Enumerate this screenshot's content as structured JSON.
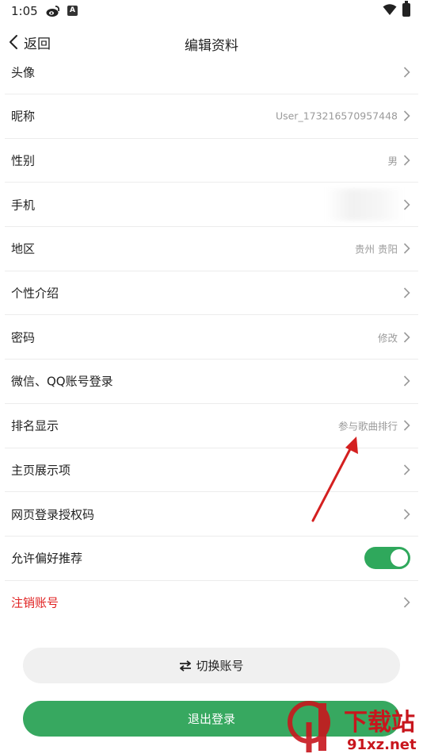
{
  "status_bar": {
    "time": "1:05",
    "icons": [
      "weibo-icon",
      "a-icon",
      "wifi-icon",
      "battery-icon"
    ],
    "a_glyph": "A"
  },
  "header": {
    "back_label": "返回",
    "title": "编辑资料"
  },
  "rows": [
    {
      "label": "头像",
      "value": ""
    },
    {
      "label": "昵称",
      "value": "User_173216570957448"
    },
    {
      "label": "性别",
      "value": "男"
    },
    {
      "label": "手机",
      "value": ""
    },
    {
      "label": "地区",
      "value": "贵州 贵阳"
    },
    {
      "label": "个性介绍",
      "value": ""
    },
    {
      "label": "密码",
      "value": "修改"
    },
    {
      "label": "微信、QQ账号登录",
      "value": ""
    },
    {
      "label": "排名显示",
      "value": "参与歌曲排行"
    },
    {
      "label": "主页展示项",
      "value": ""
    },
    {
      "label": "网页登录授权码",
      "value": ""
    },
    {
      "label": "允许偏好推荐",
      "toggle": true
    },
    {
      "label": "注销账号",
      "value": ""
    }
  ],
  "buttons": {
    "switch_account": "切换账号",
    "logout": "退出登录"
  },
  "watermark": {
    "brand": "下载站",
    "domain": "91xz.net"
  },
  "colors": {
    "accent_green": "#37a860",
    "toggle_green": "#2fa85c",
    "danger_red": "#e02020",
    "annotation_red": "#d42020",
    "watermark_red": "#c8161d"
  }
}
